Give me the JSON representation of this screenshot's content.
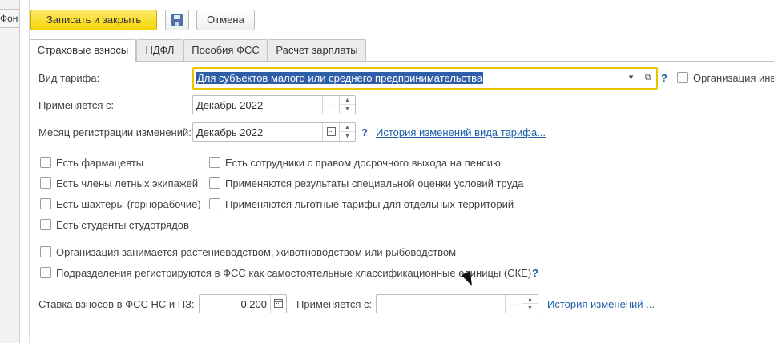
{
  "sidebar": {
    "fragment_label": "Фон"
  },
  "toolbar": {
    "save_close_label": "Записать и закрыть",
    "cancel_label": "Отмена"
  },
  "tabs": [
    {
      "label": "Страховые взносы",
      "active": true
    },
    {
      "label": "НДФЛ",
      "active": false
    },
    {
      "label": "Пособия ФСС",
      "active": false
    },
    {
      "label": "Расчет зарплаты",
      "active": false
    }
  ],
  "tariff": {
    "label": "Вид тарифа:",
    "value": "Для субъектов малого или среднего предпринимательства",
    "org_checkbox_label": "Организация инв"
  },
  "applies_from": {
    "label": "Применяется с:",
    "value": "Декабрь 2022",
    "dots": "..."
  },
  "reg_month": {
    "label": "Месяц регистрации изменений:",
    "value": "Декабрь 2022",
    "history_link": "История изменений вида тарифа..."
  },
  "help": "?",
  "checkboxes_left": [
    "Есть фармацевты",
    "Есть члены летных экипажей",
    "Есть шахтеры (горнорабочие)",
    "Есть студенты студотрядов"
  ],
  "checkboxes_right": [
    "Есть сотрудники с правом досрочного выхода на пенсию",
    "Применяются результаты специальной оценки условий труда",
    "Применяются льготные тарифы для отдельных территорий"
  ],
  "checkboxes_bottom": [
    "Организация занимается растениеводством, животноводством или рыбоводством",
    "Подразделения регистрируются в ФСС как самостоятельные классификационные единицы (СКЕ)"
  ],
  "fss_rate": {
    "label": "Ставка взносов в ФСС НС и ПЗ:",
    "value": "0,200",
    "applies_label": "Применяется с:",
    "applies_value": "",
    "dots": "...",
    "history_link": "История изменений ..."
  },
  "colors": {
    "primary": "#f5d400",
    "link": "#1f5fa8",
    "focus": "#e8c400"
  }
}
